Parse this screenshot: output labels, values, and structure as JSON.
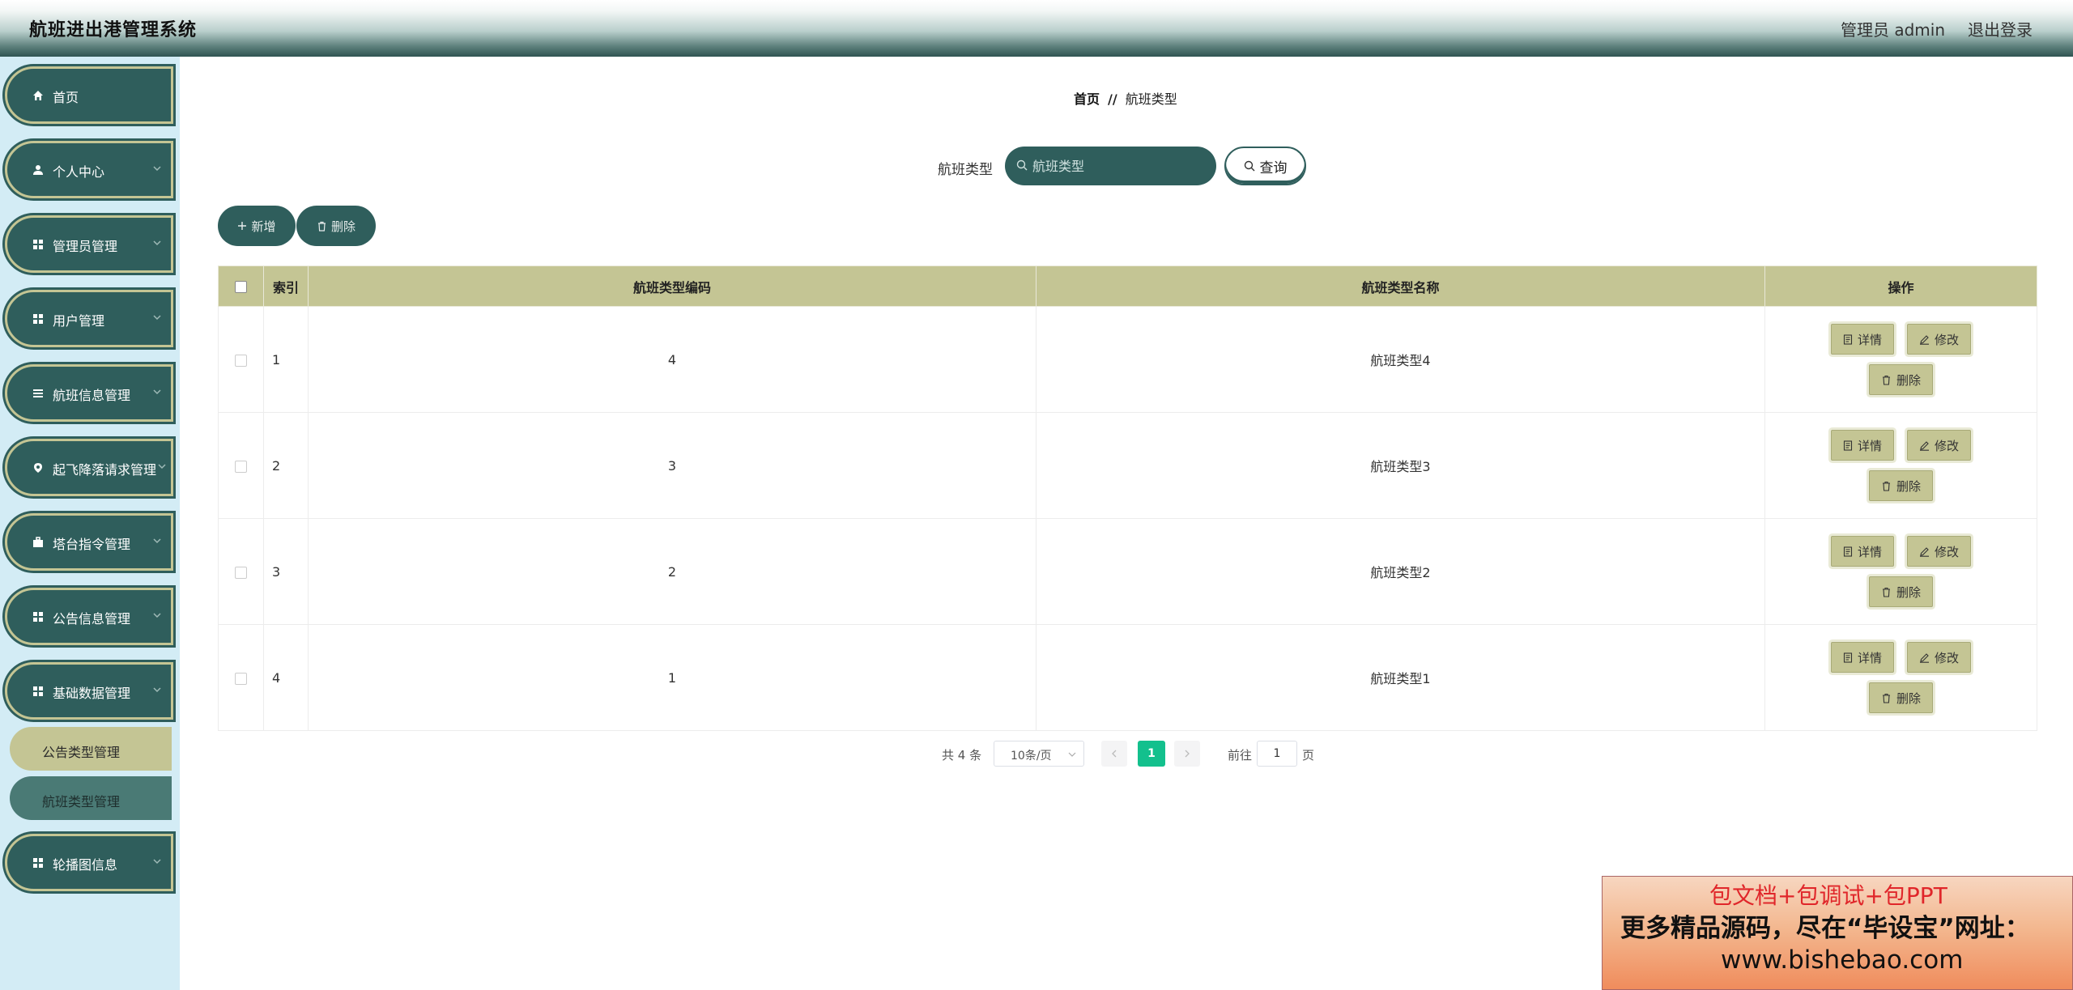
{
  "header": {
    "title": "航班进出港管理系统",
    "user": "管理员 admin",
    "logout": "退出登录"
  },
  "sidebar": {
    "items": [
      {
        "label": "首页",
        "icon": "home-icon",
        "chevron": false
      },
      {
        "label": "个人中心",
        "icon": "user-icon",
        "chevron": true
      },
      {
        "label": "管理员管理",
        "icon": "grid-icon",
        "chevron": true
      },
      {
        "label": "用户管理",
        "icon": "grid-icon",
        "chevron": true
      },
      {
        "label": "航班信息管理",
        "icon": "menu-icon",
        "chevron": true
      },
      {
        "label": "起飞降落请求管理",
        "icon": "location-icon",
        "chevron": true
      },
      {
        "label": "塔台指令管理",
        "icon": "briefcase-icon",
        "chevron": true
      },
      {
        "label": "公告信息管理",
        "icon": "grid-icon",
        "chevron": true
      },
      {
        "label": "基础数据管理",
        "icon": "grid-icon",
        "chevron": true
      }
    ],
    "subitems": [
      {
        "label": "公告类型管理"
      },
      {
        "label": "航班类型管理"
      }
    ],
    "last_item": {
      "label": "轮播图信息",
      "icon": "grid-icon",
      "chevron": true
    }
  },
  "breadcrumb": {
    "home": "首页",
    "separator": "//",
    "current": "航班类型"
  },
  "search": {
    "label": "航班类型",
    "placeholder": "航班类型",
    "button": "查询"
  },
  "actions": {
    "add": "新增",
    "delete": "删除"
  },
  "table": {
    "headers": {
      "index": "索引",
      "code": "航班类型编码",
      "name": "航班类型名称",
      "ops": "操作"
    },
    "rows": [
      {
        "index": "1",
        "code": "4",
        "name": "航班类型4"
      },
      {
        "index": "2",
        "code": "3",
        "name": "航班类型3"
      },
      {
        "index": "3",
        "code": "2",
        "name": "航班类型2"
      },
      {
        "index": "4",
        "code": "1",
        "name": "航班类型1"
      }
    ],
    "row_ops": {
      "detail": "详情",
      "edit": "修改",
      "delete": "删除"
    }
  },
  "pagination": {
    "total": "共 4 条",
    "page_size": "10条/页",
    "current": "1",
    "goto": "前往",
    "goto_value": "1",
    "page_unit": "页"
  },
  "watermark": {
    "line1": "包文档+包调试+包PPT",
    "line2": "更多精品源码，尽在“毕设宝”网址：",
    "line3": "www.bishebao.com"
  },
  "colors": {
    "primary": "#2f5e5c",
    "accent": "#c4c594",
    "active_page": "#13c08d",
    "sidebar_bg": "#d3ecf5"
  }
}
